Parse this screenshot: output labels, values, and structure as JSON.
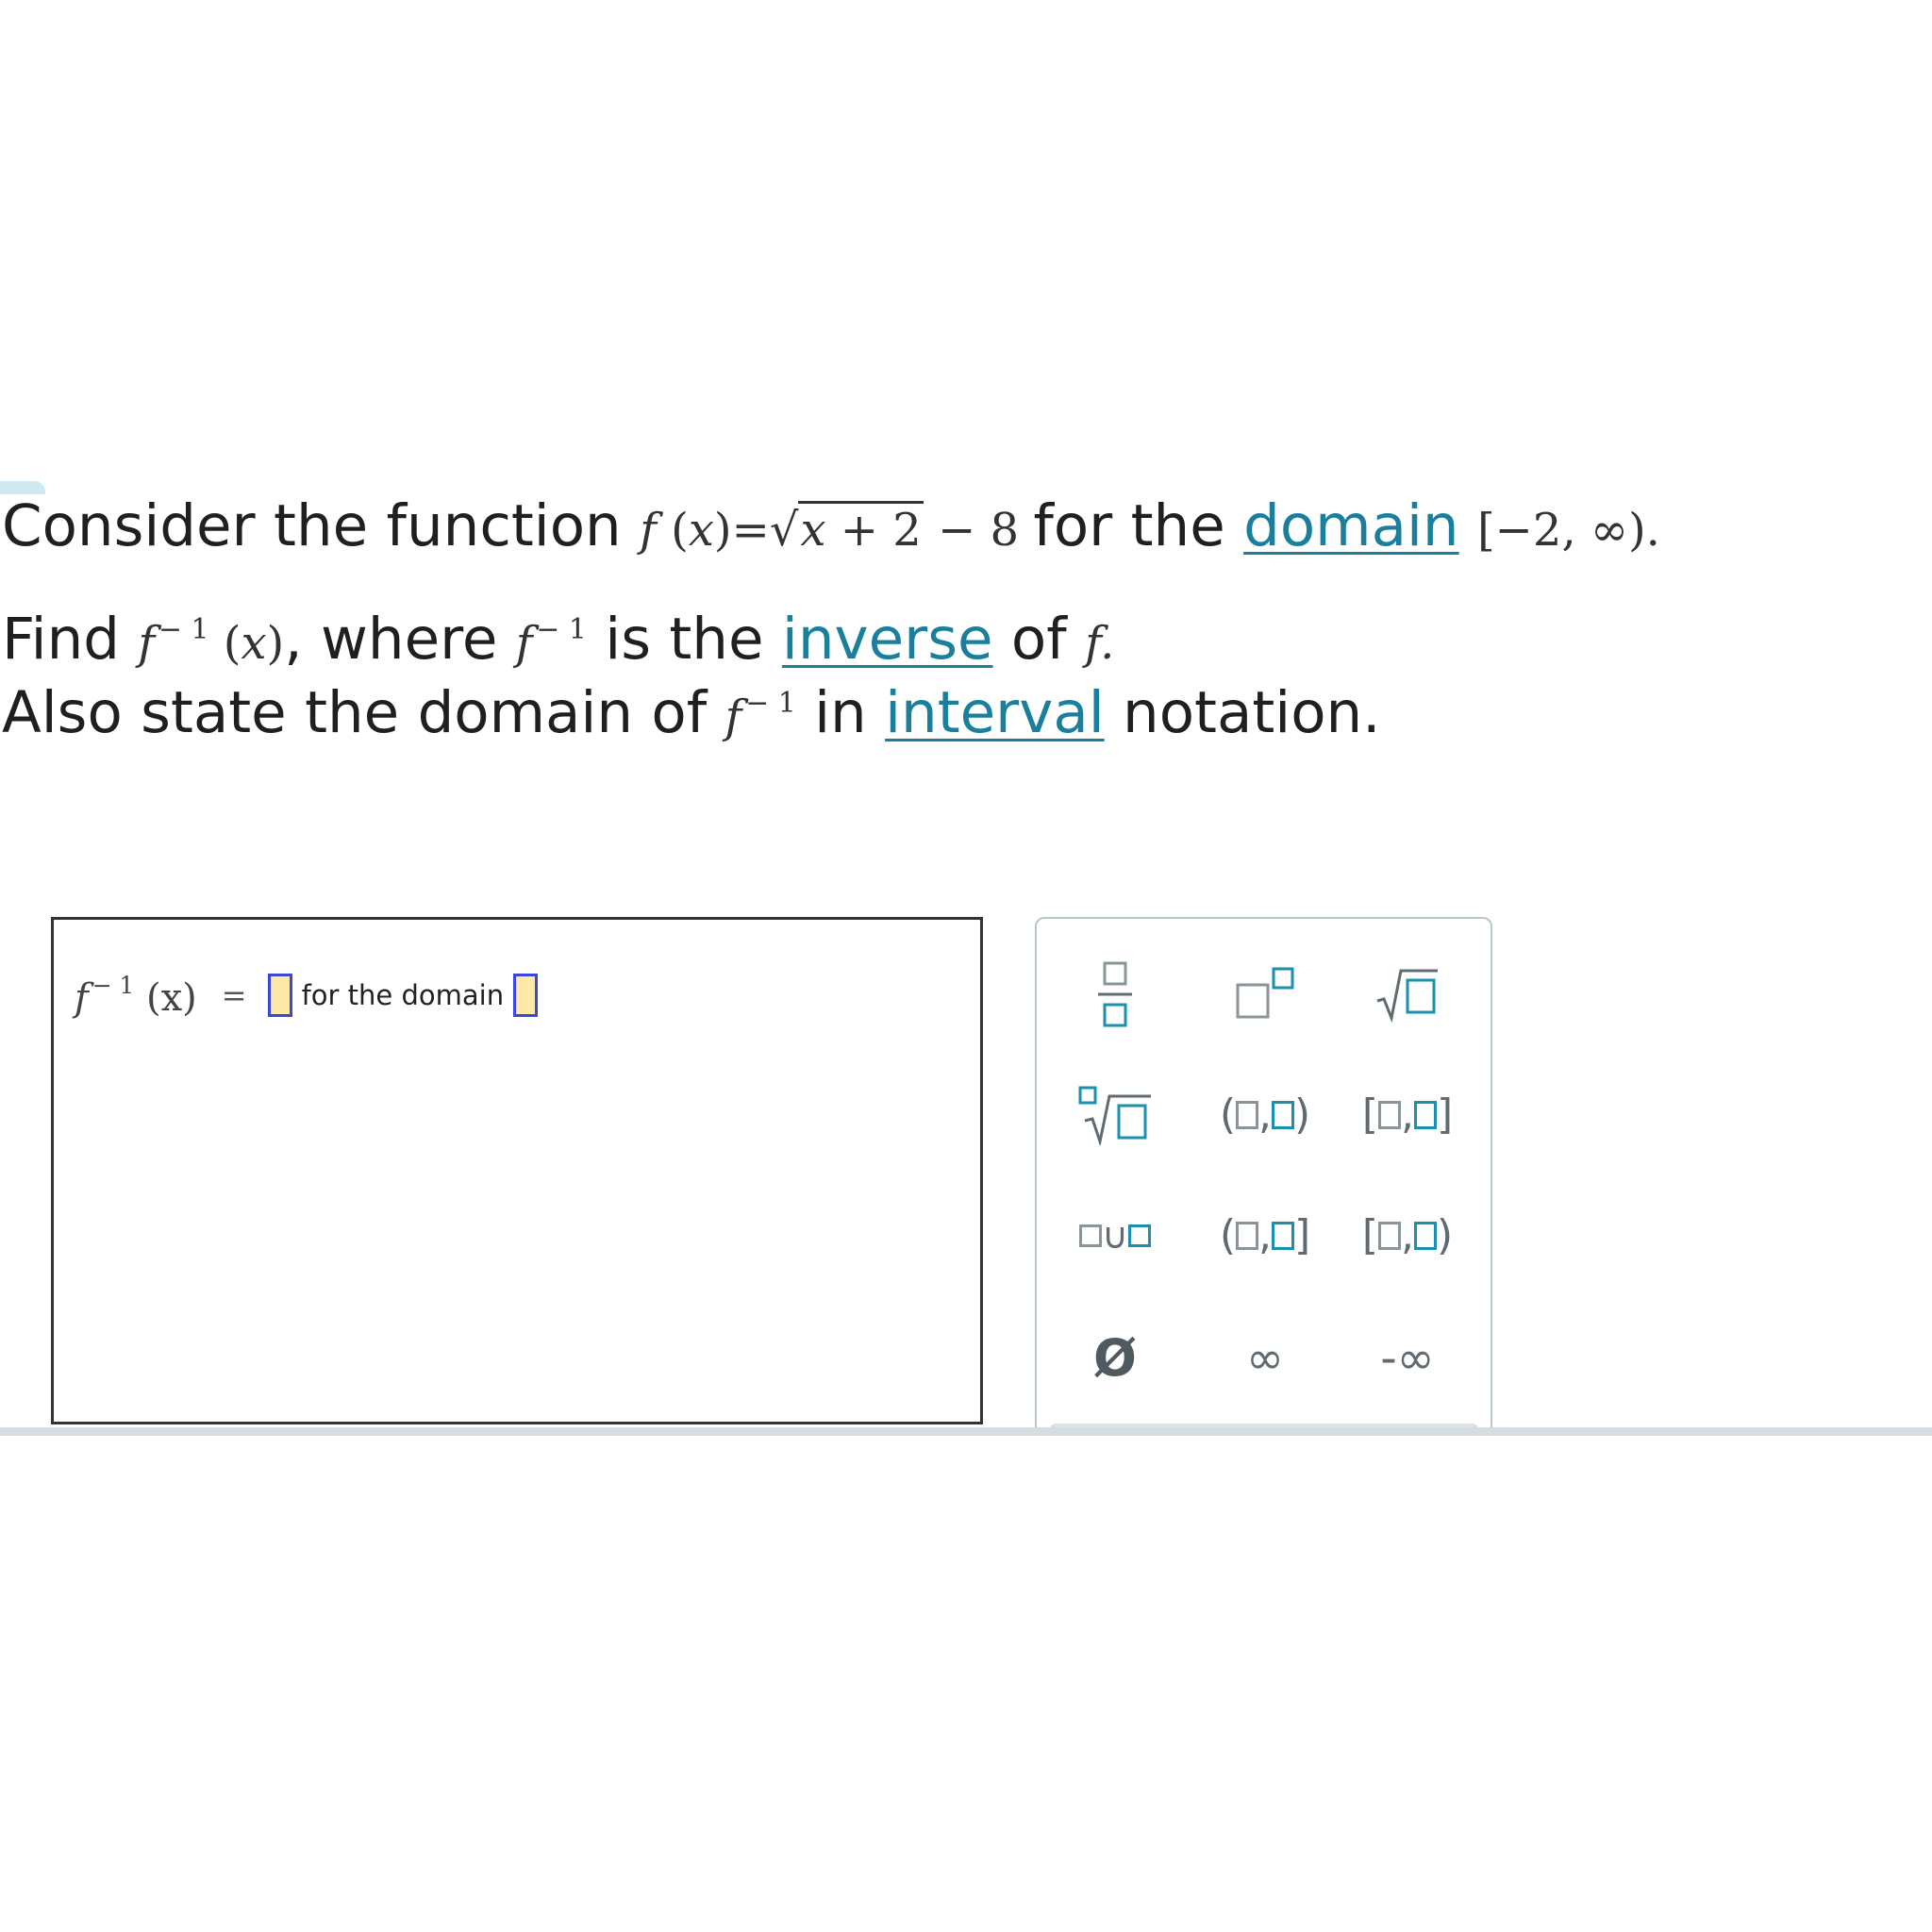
{
  "question": {
    "line1_prefix": "Consider the function",
    "line1_function": "f(x)=√x+2 − 8",
    "line1_mid": "for the",
    "domain_link": "domain",
    "line1_interval": "[−2, ∞).",
    "line2_prefix": "Find",
    "line2_mid": ", where",
    "line2_is": "is the",
    "inverse_link": "inverse",
    "line2_of": "of",
    "line3_prefix": "Also state the domain of",
    "line3_in": "in",
    "interval_link": "interval",
    "line3_suffix": "notation."
  },
  "answer": {
    "lhs_f": "f",
    "lhs_exp": "− 1",
    "lhs_arg": "(x)",
    "equals": "=",
    "for_the_domain": "for the domain"
  },
  "keypad": {
    "keys": [
      {
        "name": "fraction-key"
      },
      {
        "name": "superscript-key"
      },
      {
        "name": "square-root-key"
      },
      {
        "name": "nth-root-key"
      },
      {
        "name": "open-interval-key",
        "left": "(",
        "comma": ",",
        "right": ")"
      },
      {
        "name": "closed-interval-key",
        "left": "[",
        "comma": ",",
        "right": "]"
      },
      {
        "name": "union-key",
        "symbol": "∪"
      },
      {
        "name": "left-open-interval-key",
        "left": "(",
        "comma": ",",
        "right": "]"
      },
      {
        "name": "right-open-interval-key",
        "left": "[",
        "comma": ",",
        "right": ")"
      },
      {
        "name": "empty-set-key",
        "symbol": "Ø"
      },
      {
        "name": "infinity-key",
        "symbol": "∞"
      },
      {
        "name": "negative-infinity-key",
        "symbol": "-∞"
      }
    ]
  },
  "colors": {
    "link": "#1a7f9c",
    "slot_fill": "#fde9a9",
    "slot_border": "#3c46d8",
    "key_accent": "#1a8fb0",
    "key_gray": "#8a9599"
  }
}
